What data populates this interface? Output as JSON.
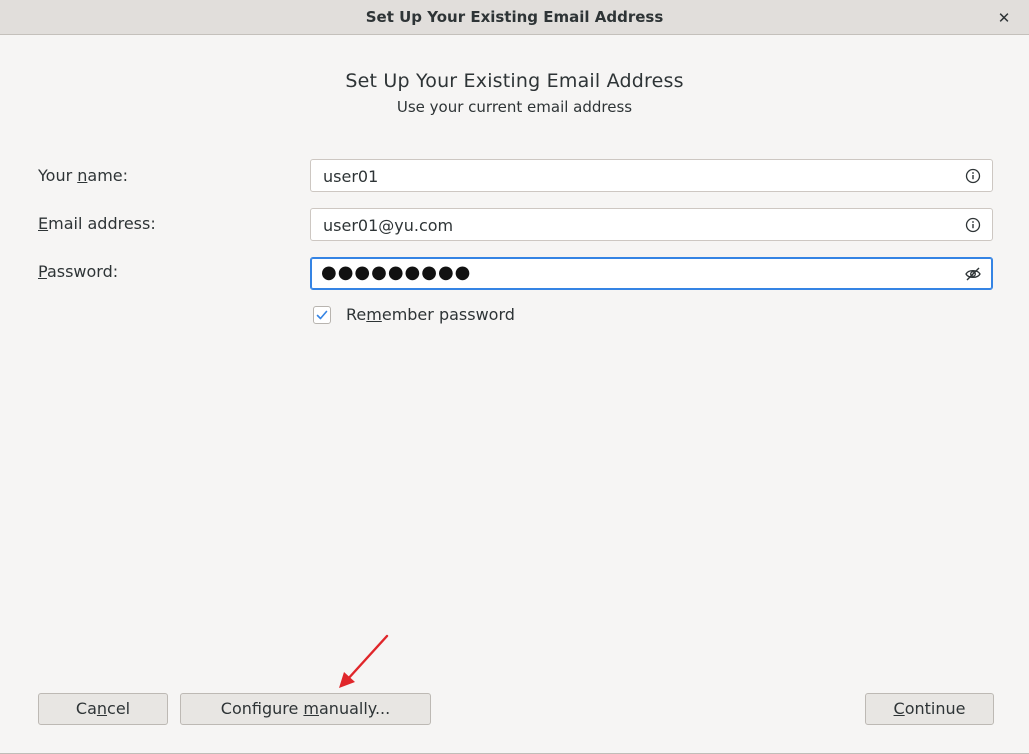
{
  "window": {
    "title": "Set Up Your Existing Email Address",
    "close_glyph": "✕"
  },
  "header": {
    "title": "Set Up Your Existing Email Address",
    "subtitle": "Use your current email address"
  },
  "form": {
    "name": {
      "label_before": "Your ",
      "label_mnemonic": "n",
      "label_after": "ame:",
      "value": "user01",
      "icon": "info-icon"
    },
    "email": {
      "label_before": "",
      "label_mnemonic": "E",
      "label_after": "mail address:",
      "value": "user01@yu.com",
      "icon": "info-icon"
    },
    "password": {
      "label_before": "",
      "label_mnemonic": "P",
      "label_after": "assword:",
      "masked_value": "●●●●●●●●●",
      "icon": "eye-slash-icon"
    },
    "remember": {
      "label_before": "Re",
      "label_mnemonic": "m",
      "label_after": "ember password",
      "checked": true
    }
  },
  "buttons": {
    "cancel": {
      "before": "Ca",
      "mnemonic": "n",
      "after": "cel"
    },
    "configure": {
      "before": "Configure ",
      "mnemonic": "m",
      "after": "anually..."
    },
    "continue": {
      "before": "",
      "mnemonic": "C",
      "after": "ontinue"
    }
  },
  "colors": {
    "accent": "#3584e4",
    "annotation_arrow": "#e0262a"
  }
}
